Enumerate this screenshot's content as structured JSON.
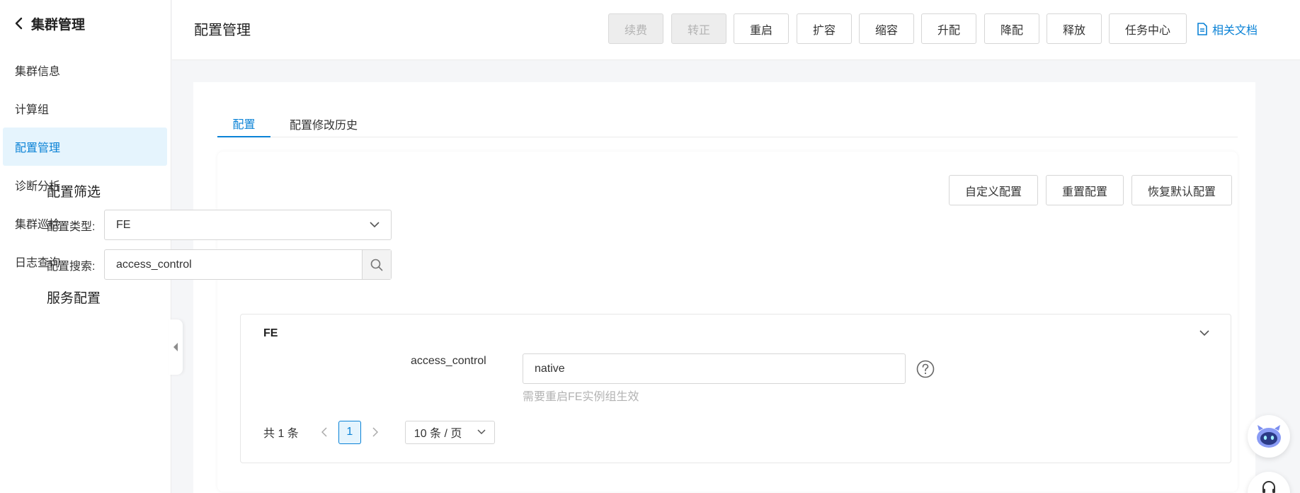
{
  "sidebar": {
    "title": "集群管理",
    "items": [
      {
        "label": "集群信息"
      },
      {
        "label": "计算组"
      },
      {
        "label": "配置管理"
      },
      {
        "label": "诊断分析"
      },
      {
        "label": "集群巡检"
      },
      {
        "label": "日志查询"
      }
    ],
    "active_index": 2
  },
  "header": {
    "title": "配置管理",
    "buttons": [
      {
        "label": "续费",
        "disabled": true
      },
      {
        "label": "转正",
        "disabled": true
      },
      {
        "label": "重启"
      },
      {
        "label": "扩容"
      },
      {
        "label": "缩容"
      },
      {
        "label": "升配"
      },
      {
        "label": "降配"
      },
      {
        "label": "释放"
      },
      {
        "label": "任务中心"
      }
    ],
    "doc_link": "相关文档"
  },
  "tabs": [
    {
      "label": "配置",
      "active": true
    },
    {
      "label": "配置修改历史"
    }
  ],
  "filter": {
    "title": "配置筛选",
    "actions": [
      "自定义配置",
      "重置配置",
      "恢复默认配置"
    ],
    "type_label": "配置类型:",
    "type_value": "FE",
    "search_label": "配置搜索:",
    "search_value": "access_control"
  },
  "service": {
    "title": "服务配置",
    "panel_title": "FE",
    "config_key": "access_control",
    "config_value": "native",
    "hint": "需要重启FE实例组生效",
    "pagination": {
      "total": "共 1 条",
      "current": "1",
      "page_size": "10 条 / 页"
    }
  },
  "colors": {
    "primary": "#0a82d6",
    "active_bg": "#e5f4fd",
    "page_bg": "#f5f6f8"
  }
}
